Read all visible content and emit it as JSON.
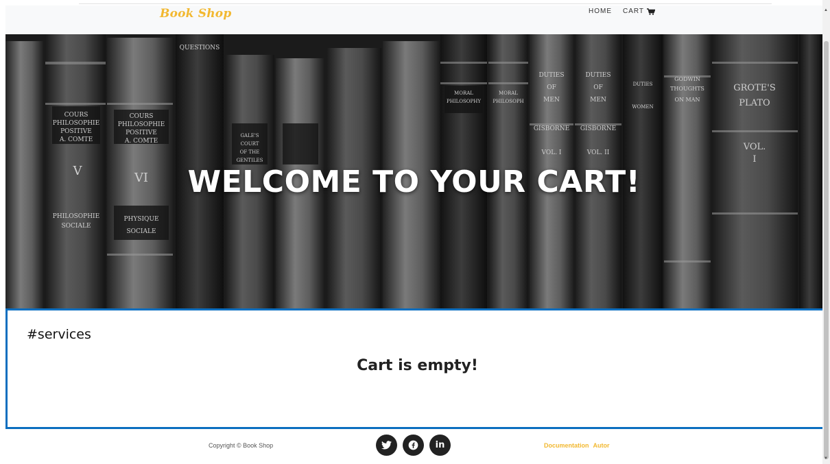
{
  "navbar": {
    "brand": "Book Shop",
    "links": [
      {
        "label": "HOME"
      },
      {
        "label": "CART"
      }
    ]
  },
  "hero": {
    "title": "WELCOME TO YOUR CART!",
    "spines": [
      "QUESTIONS",
      "COURS DE PHILOSOPHIE POSITIVE A. COMTE",
      "VI",
      "PHYSIQUE SOCIALE",
      "GALE'S COURT OF THE GENTILES",
      "MORAL PHILOSOPHY",
      "DUTIES OF MEN",
      "GISBORNE",
      "VOL. I",
      "VOL. II",
      "GODWIN THOUGHTS ON MAN",
      "GROTE'S PLATO"
    ]
  },
  "services": {
    "label": "#services",
    "message": "Cart is empty!"
  },
  "footer": {
    "copyright": "Copyright © Book Shop",
    "social": [
      {
        "icon": "twitter-icon",
        "glyph": "t"
      },
      {
        "icon": "facebook-icon",
        "glyph": "f"
      },
      {
        "icon": "linkedin-icon",
        "glyph": "in"
      }
    ],
    "links": [
      {
        "label": "Documentation"
      },
      {
        "label": "Autor"
      }
    ]
  },
  "colors": {
    "brand": "#f2b830",
    "services_border": "#0b6ebf",
    "social_bg": "#222222"
  }
}
